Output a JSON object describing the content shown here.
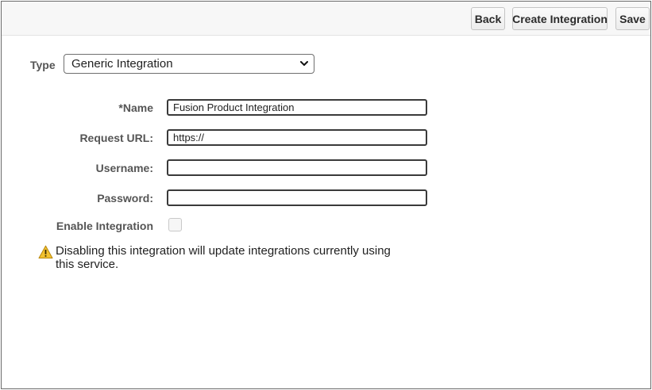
{
  "toolbar": {
    "back_label": "Back",
    "create_label": "Create Integration",
    "save_label": "Save"
  },
  "type": {
    "label": "Type",
    "selected": "Generic Integration"
  },
  "form": {
    "name_label": "*Name",
    "name_value": "Fusion Product Integration",
    "url_label": "Request URL:",
    "url_value": "https://",
    "username_label": "Username:",
    "username_value": "",
    "password_label": "Password:",
    "password_value": "",
    "enable_label": "Enable Integration",
    "enable_checked": false
  },
  "warning": {
    "text": "Disabling this integration will update integrations currently using this service.",
    "icon": "warning-triangle-icon",
    "icon_color": "#f2c230"
  }
}
